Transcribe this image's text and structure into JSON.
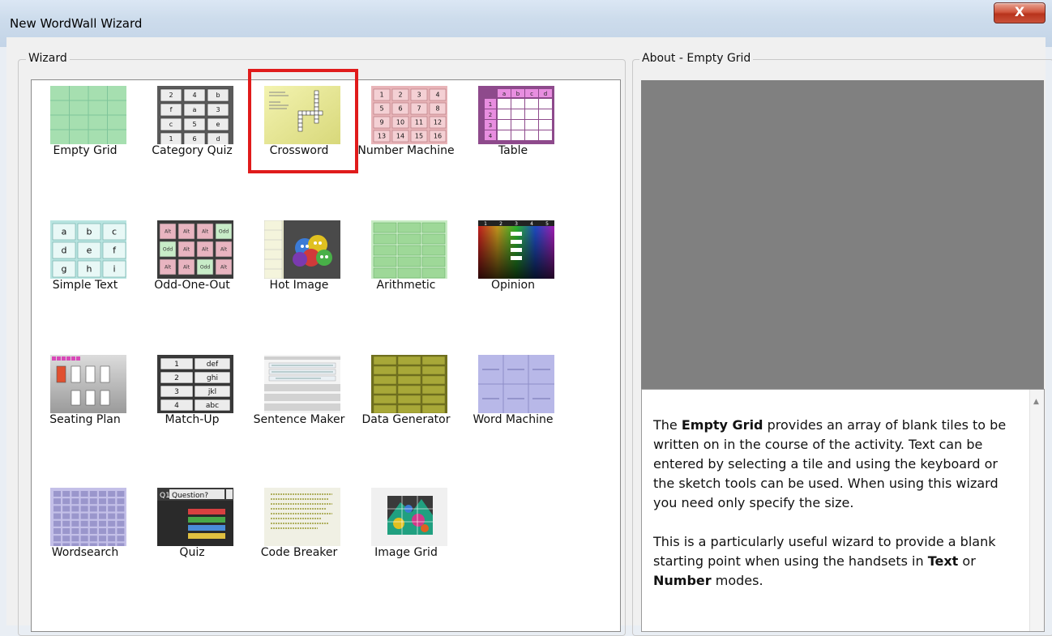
{
  "window": {
    "title": "New WordWall Wizard",
    "close_label": "X"
  },
  "wizard_group": {
    "label": "Wizard"
  },
  "about_group": {
    "label": "About - Empty Grid"
  },
  "wizards": [
    {
      "label": "Empty Grid"
    },
    {
      "label": "Category Quiz"
    },
    {
      "label": "Crossword"
    },
    {
      "label": "Number Machine"
    },
    {
      "label": "Table"
    },
    {
      "label": "Simple Text"
    },
    {
      "label": "Odd-One-Out"
    },
    {
      "label": "Hot Image"
    },
    {
      "label": "Arithmetic"
    },
    {
      "label": "Opinion"
    },
    {
      "label": "Seating Plan"
    },
    {
      "label": "Match-Up"
    },
    {
      "label": "Sentence Maker"
    },
    {
      "label": "Data Generator"
    },
    {
      "label": "Word Machine"
    },
    {
      "label": "Wordsearch"
    },
    {
      "label": "Quiz"
    },
    {
      "label": "Code Breaker"
    },
    {
      "label": "Image Grid"
    }
  ],
  "selected_wizard": "Crossword",
  "description": {
    "p1_pre": "The ",
    "p1_bold": "Empty Grid",
    "p1_post": " provides an array of blank tiles to be written on in the course of the activity. Text can be entered by selecting a tile and using the keyboard or the sketch tools can be used. When using this wizard you need only specify the size.",
    "p2_pre": "This is a particularly useful wizard to provide a blank starting point when using the handsets in ",
    "p2_bold1": "Text",
    "p2_mid": " or ",
    "p2_bold2": "Number",
    "p2_post": " modes."
  },
  "thumb_text": {
    "category_quiz": [
      "2",
      "4",
      "b",
      "f",
      "a",
      "3",
      "c",
      "5",
      "e",
      "1",
      "6",
      "d"
    ],
    "number_machine": [
      "1",
      "2",
      "3",
      "4",
      "5",
      "6",
      "7",
      "8",
      "9",
      "10",
      "11",
      "12",
      "13",
      "14",
      "15",
      "16"
    ],
    "table_header": [
      "a",
      "b",
      "c",
      "d"
    ],
    "table_rows": [
      "1",
      "2",
      "3",
      "4"
    ],
    "simple_text": [
      "a",
      "b",
      "c",
      "d",
      "e",
      "f",
      "g",
      "h",
      "i"
    ],
    "odd_one_out": [
      "Alt",
      "Alt",
      "Alt",
      "Odd",
      "Odd",
      "Alt",
      "Alt",
      "Alt",
      "Alt",
      "Alt",
      "Odd",
      "Alt"
    ],
    "match_up": [
      "1",
      "def",
      "2",
      "ghi",
      "3",
      "jkl",
      "4",
      "abc"
    ],
    "opinion_header": [
      "1",
      "2",
      "3",
      "4",
      "5"
    ],
    "quiz": [
      "Q1",
      "Question?"
    ]
  },
  "colors": {
    "preview_bg": "#808080",
    "selection_border": "#e01b1b",
    "empty_grid": "#a6dfb0",
    "number_machine": "#e8b4b8",
    "table": "#8e4a8c",
    "simple_text": "#b8e4e0",
    "data_generator": "#8f8f2a",
    "word_machine": "#b8b8e8"
  }
}
